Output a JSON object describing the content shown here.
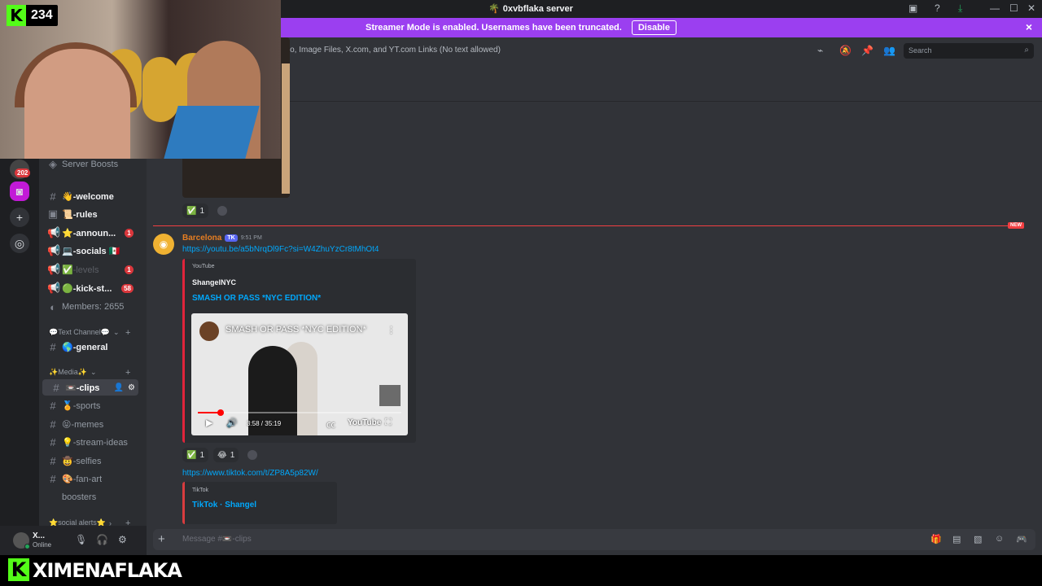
{
  "window": {
    "title": "0xvbflaka server",
    "controls": [
      "—",
      "☐",
      "✕"
    ]
  },
  "banner": {
    "text": "Streamer Mode is enabled. Usernames have been truncated.",
    "disable_label": "Disable",
    "close_icon": "×"
  },
  "overlay": {
    "viewer_count": "234",
    "streamer_name": "XIMENAFLAKA",
    "kick_letter": "K"
  },
  "rail": {
    "badge": "202"
  },
  "sidebar": {
    "server_boosts": "Server Boosts",
    "members": "Members: 2655",
    "channels": [
      {
        "name": "👋-welcome",
        "badge": ""
      },
      {
        "name": "📜-rules",
        "badge": ""
      },
      {
        "name": "⭐-announ...",
        "badge": "1"
      },
      {
        "name": "💻-socials 🇲🇽",
        "badge": ""
      },
      {
        "name": "✅-levels",
        "badge": "1"
      },
      {
        "name": "🟢-kick-st...",
        "badge": "58"
      }
    ],
    "cat_text": "💬Text Channel💬",
    "general": "🌎-general",
    "cat_media": "✨Media✨",
    "media_channels": [
      "📼-clips",
      "🏅-sports",
      "😝-memes",
      "💡-stream-ideas",
      "🤠-selfies",
      "🎨-fan-art"
    ],
    "boosters": "boosters",
    "cat_social": "⭐social alerts⭐"
  },
  "user": {
    "name": "X...",
    "status": "Online"
  },
  "main": {
    "topic": "deo, Image Files, X.com, and YT.com Links (No text allowed)",
    "search_placeholder": "Search",
    "prev_reaction_count": "1",
    "new_label": "NEW",
    "message": {
      "author": "Barcelona",
      "tag": "TK",
      "time": "9:51 PM",
      "link1": "https://youtu.be/a5bNrqDl9Fc?si=W4ZhuYzCr8tMhOt4",
      "embed1": {
        "provider": "YouTube",
        "author": "ShangelNYC",
        "title": "SMASH OR PASS *NYC EDITION*",
        "video_title": "SMASH OR PASS *NYC EDITION*",
        "time": "3:58 / 35:19",
        "progress": 0.113,
        "brand": "YouTube"
      },
      "reactions": [
        {
          "emoji": "✅",
          "count": "1"
        },
        {
          "emoji": "😂",
          "count": "1"
        }
      ],
      "link2": "https://www.tiktok.com/t/ZP8A5p82W/",
      "embed2": {
        "provider": "TikTok",
        "title": "TikTok · Shangel"
      }
    },
    "composer_placeholder": "Message #📼-clips"
  }
}
